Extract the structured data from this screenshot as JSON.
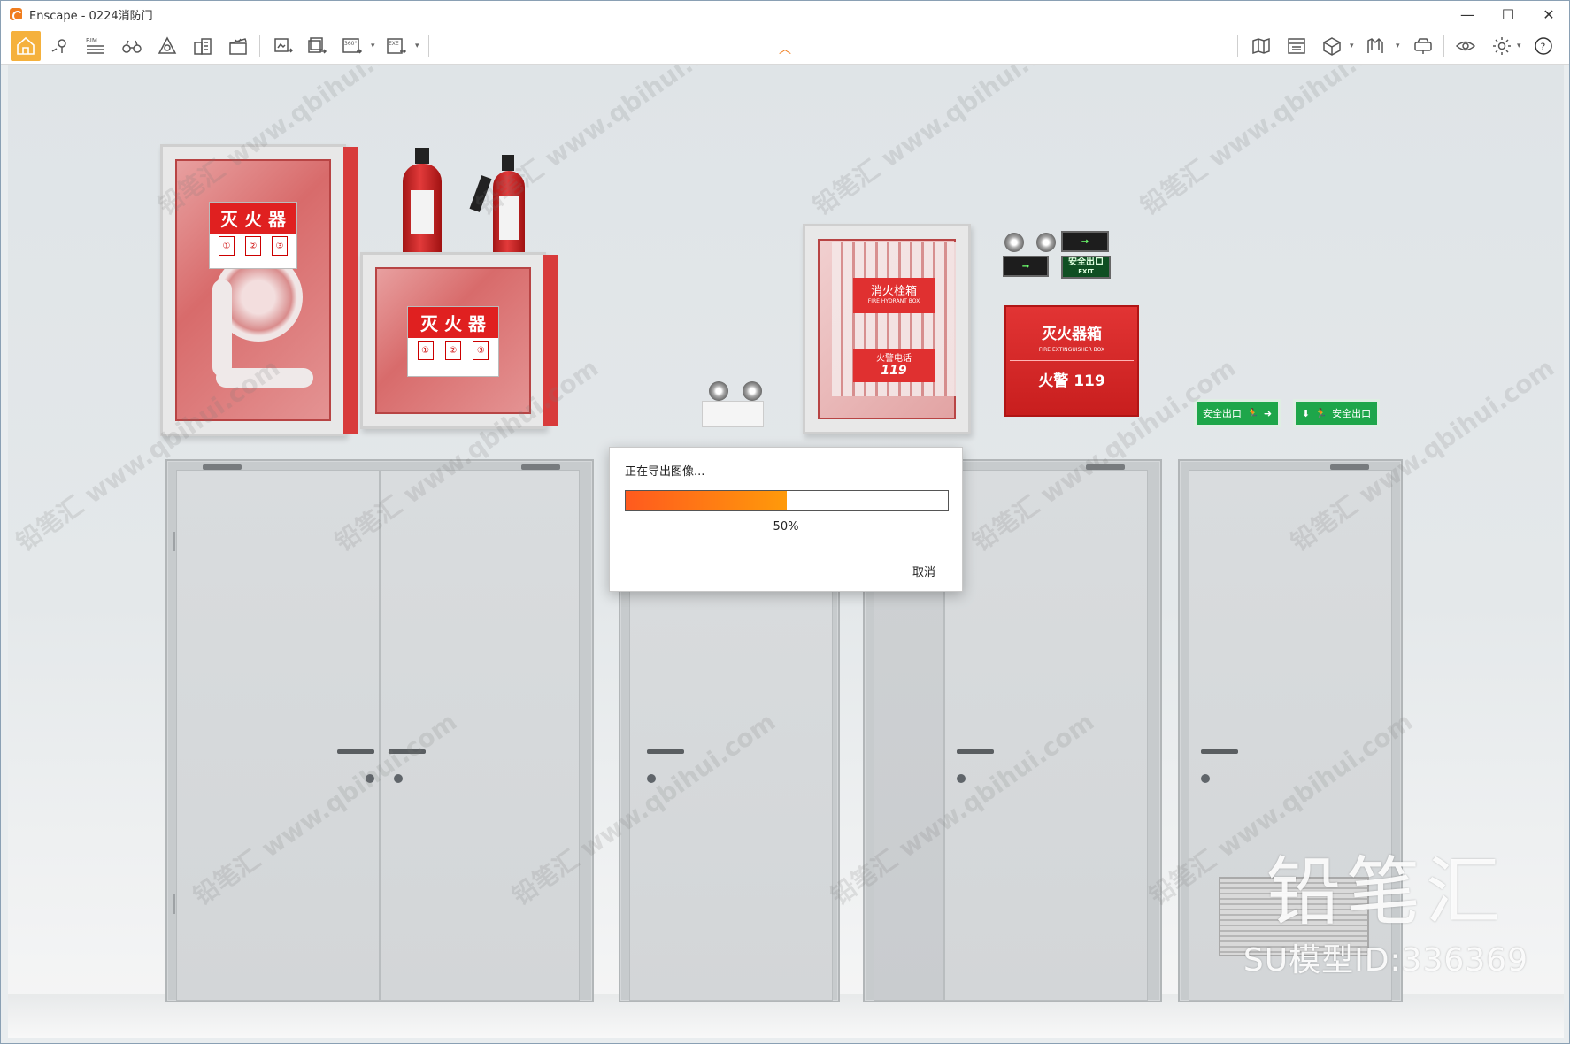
{
  "window": {
    "app_name": "Enscape",
    "title": "Enscape - 0224消防门",
    "controls": {
      "minimize": "—",
      "maximize": "☐",
      "close": "✕"
    }
  },
  "toolbar": {
    "left_buttons": [
      {
        "name": "home-icon",
        "caret": false
      },
      {
        "name": "map-pin-icon",
        "caret": false
      },
      {
        "name": "bim-icon",
        "caret": false,
        "label": "BIM"
      },
      {
        "name": "binoculars-icon",
        "caret": false
      },
      {
        "name": "perspective-icon",
        "caret": false
      },
      {
        "name": "buildings-icon",
        "caret": false
      },
      {
        "name": "clapboard-icon",
        "caret": false
      },
      {
        "name": "screenshot-export-icon",
        "caret": false
      },
      {
        "name": "batch-export-icon",
        "caret": false
      },
      {
        "name": "panorama-360-icon",
        "caret": true,
        "label": "360°"
      },
      {
        "name": "exe-export-icon",
        "caret": true,
        "label": "EXE"
      }
    ],
    "right_buttons": [
      {
        "name": "map-icon",
        "caret": false
      },
      {
        "name": "asset-library-icon",
        "caret": false
      },
      {
        "name": "cube-icon",
        "caret": true
      },
      {
        "name": "chart-book-icon",
        "caret": true
      },
      {
        "name": "vr-headset-icon",
        "caret": false
      },
      {
        "name": "eye-icon",
        "caret": false
      },
      {
        "name": "gear-icon",
        "caret": true
      },
      {
        "name": "help-icon",
        "caret": false,
        "label": "?"
      }
    ]
  },
  "scene": {
    "cabinet_labels": {
      "extinguisher_1": "灭 火 器",
      "extinguisher_2": "灭 火 器",
      "hydrant": "消火栓箱",
      "hydrant_sub": "FIRE HYDRANT BOX",
      "fire_call": "火警电话",
      "fire_call_number": "119",
      "ext_box_title": "灭火器箱",
      "ext_box_sub": "FIRE EXTINGUISHER BOX",
      "ext_box_alarm": "火警 119"
    },
    "signs": {
      "exit_top": "安全出口",
      "exit_bottom": "安全出口",
      "exit_en": "EXIT",
      "green_left": "安全出口",
      "green_right": "安全出口"
    },
    "watermark_text": "铅笔汇 www.qbihui.com",
    "brand": {
      "name": "铅笔汇",
      "model_id": "SU模型ID:336369"
    }
  },
  "dialog": {
    "title": "正在导出图像...",
    "progress": 0.5,
    "progress_text": "50%",
    "cancel_label": "取消",
    "fill_start": "#ff5a1e",
    "fill_end": "#ff9a0a"
  },
  "colors": {
    "accent": "#f5b13d",
    "brand_orange": "#f07d1e",
    "fire_red": "#e02020",
    "exit_green": "#1ea64a"
  }
}
